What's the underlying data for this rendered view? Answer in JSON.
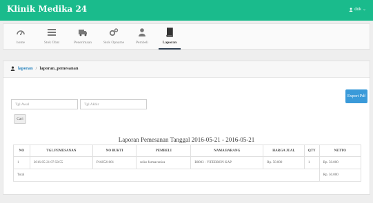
{
  "app": {
    "title": "Klinik Medika 24"
  },
  "user": {
    "name": "dok"
  },
  "nav": {
    "items": [
      {
        "label": "home",
        "icon": "dashboard-icon"
      },
      {
        "label": "Stok Obat",
        "icon": "list-icon"
      },
      {
        "label": "Penerimaan",
        "icon": "truck-icon"
      },
      {
        "label": "Stok Opname",
        "icon": "cogs-icon"
      },
      {
        "label": "Pembeli",
        "icon": "user-icon"
      },
      {
        "label": "Laporan",
        "icon": "book-icon",
        "active": true
      }
    ]
  },
  "breadcrumb": {
    "parent": "laporan",
    "separator": "/",
    "current": "laporan_pemesanan"
  },
  "filter": {
    "start_placeholder": "Tgl Awal",
    "end_placeholder": "Tgl Akhir",
    "search_label": "Cari",
    "export_label": "Export Pdf"
  },
  "report": {
    "title": "Laporan Pemesanan Tanggal 2016-05-21 - 2016-05-21",
    "columns": [
      "NO",
      "TGL PEMESANAN",
      "NO BUKTI",
      "PEMBELI",
      "NAMA BARANG",
      "HARGA JUAL",
      "QTY",
      "NETTO"
    ],
    "rows": [
      [
        "1",
        "2016-05-21 07:58:55",
        "P160521001",
        "reiko farmavenica",
        "B0003 - VIFERRON KAP",
        "Rp. 50.000",
        "1",
        "Rp. 50.000"
      ]
    ],
    "total_label": "Total",
    "total_value": "Rp. 50.000"
  },
  "colors": {
    "topbar": "#1abb8c",
    "link": "#1a7bb9",
    "button_primary": "#3a9ad9"
  }
}
